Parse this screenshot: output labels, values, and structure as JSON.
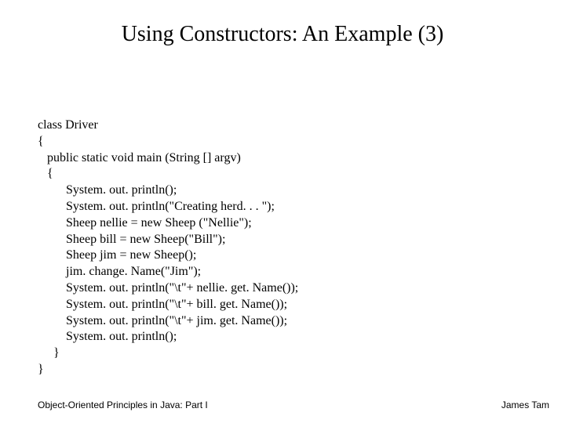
{
  "title": "Using Constructors: An Example (3)",
  "code": "class Driver\n{\n   public static void main (String [] argv)\n   {\n         System. out. println();\n         System. out. println(\"Creating herd. . . \");\n         Sheep nellie = new Sheep (\"Nellie\");\n         Sheep bill = new Sheep(\"Bill\");\n         Sheep jim = new Sheep();\n         jim. change. Name(\"Jim\");\n         System. out. println(\"\\t\"+ nellie. get. Name());\n         System. out. println(\"\\t\"+ bill. get. Name());\n         System. out. println(\"\\t\"+ jim. get. Name());\n         System. out. println();\n     }\n}",
  "footer": {
    "left": "Object-Oriented Principles in Java: Part I",
    "right": "James Tam"
  }
}
